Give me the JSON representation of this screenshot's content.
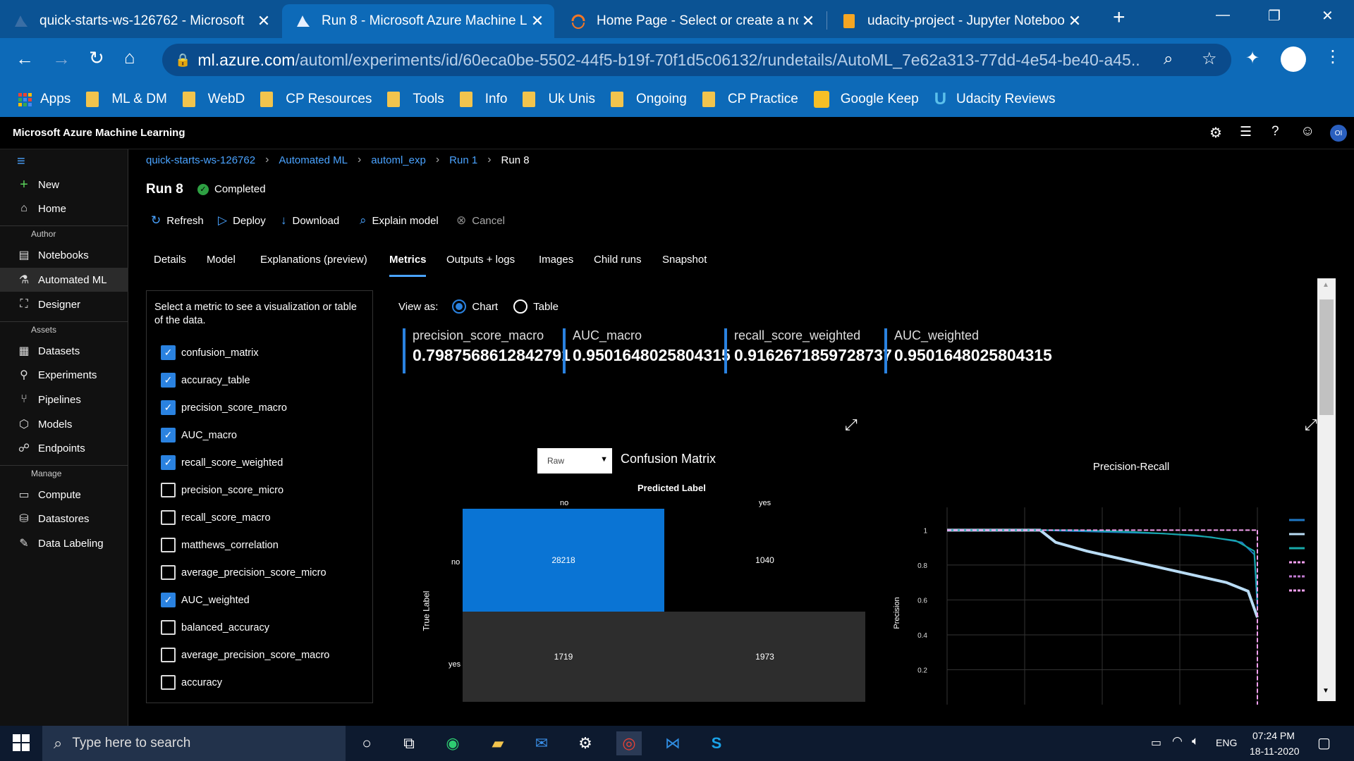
{
  "browser": {
    "tabs": [
      {
        "title": "quick-starts-ws-126762 - Microsoft",
        "icon": "azure-icon"
      },
      {
        "title": "Run 8 - Microsoft Azure Machine Le",
        "icon": "azure-ml-icon"
      },
      {
        "title": "Home Page - Select or create a note",
        "icon": "jupyter-icon"
      },
      {
        "title": "udacity-project - Jupyter Notebook",
        "icon": "notebook-icon"
      }
    ],
    "url_host": "ml.azure.com",
    "url_path": "/automl/experiments/id/60eca0be-5502-44f5-b19f-70f1d5c06132/rundetails/AutoML_7e62a313-77dd-4e54-be40-a45...",
    "bookmarks": [
      "Apps",
      "ML & DM",
      "WebD",
      "CP Resources",
      "Tools",
      "Info",
      "Uk Unis",
      "Ongoing",
      "CP Practice",
      "Google Keep",
      "Udacity Reviews"
    ]
  },
  "app": {
    "title": "Microsoft Azure Machine Learning",
    "avatar": "OI"
  },
  "sidebar": {
    "top": [
      {
        "label": "New",
        "icon": "plus-icon"
      },
      {
        "label": "Home",
        "icon": "home-icon"
      }
    ],
    "author_label": "Author",
    "author": [
      {
        "label": "Notebooks",
        "icon": "notebook-icon"
      },
      {
        "label": "Automated ML",
        "icon": "automl-icon"
      },
      {
        "label": "Designer",
        "icon": "designer-icon"
      }
    ],
    "assets_label": "Assets",
    "assets": [
      {
        "label": "Datasets",
        "icon": "dataset-icon"
      },
      {
        "label": "Experiments",
        "icon": "flask-icon"
      },
      {
        "label": "Pipelines",
        "icon": "pipeline-icon"
      },
      {
        "label": "Models",
        "icon": "cube-icon"
      },
      {
        "label": "Endpoints",
        "icon": "endpoint-icon"
      }
    ],
    "manage_label": "Manage",
    "manage": [
      {
        "label": "Compute",
        "icon": "monitor-icon"
      },
      {
        "label": "Datastores",
        "icon": "database-icon"
      },
      {
        "label": "Data Labeling",
        "icon": "edit-icon"
      }
    ]
  },
  "breadcrumb": [
    "quick-starts-ws-126762",
    "Automated ML",
    "automl_exp",
    "Run 1",
    "Run 8"
  ],
  "run": {
    "title": "Run 8",
    "status": "Completed"
  },
  "toolbar": {
    "refresh": "Refresh",
    "deploy": "Deploy",
    "download": "Download",
    "explain": "Explain model",
    "cancel": "Cancel"
  },
  "tabs": [
    "Details",
    "Model",
    "Explanations (preview)",
    "Metrics",
    "Outputs + logs",
    "Images",
    "Child runs",
    "Snapshot"
  ],
  "active_tab": "Metrics",
  "metrics_panel": {
    "instruction": "Select a metric to see a visualization or table of the data.",
    "items": [
      {
        "label": "confusion_matrix",
        "checked": true
      },
      {
        "label": "accuracy_table",
        "checked": true
      },
      {
        "label": "precision_score_macro",
        "checked": true
      },
      {
        "label": "AUC_macro",
        "checked": true
      },
      {
        "label": "recall_score_weighted",
        "checked": true
      },
      {
        "label": "precision_score_micro",
        "checked": false
      },
      {
        "label": "recall_score_macro",
        "checked": false
      },
      {
        "label": "matthews_correlation",
        "checked": false
      },
      {
        "label": "average_precision_score_micro",
        "checked": false
      },
      {
        "label": "AUC_weighted",
        "checked": true
      },
      {
        "label": "balanced_accuracy",
        "checked": false
      },
      {
        "label": "average_precision_score_macro",
        "checked": false
      },
      {
        "label": "accuracy",
        "checked": false
      }
    ]
  },
  "view_as": {
    "label": "View as:",
    "chart": "Chart",
    "table": "Table",
    "selected": "Chart"
  },
  "kpis": [
    {
      "name": "precision_score_macro",
      "value": "0.7987568612842791"
    },
    {
      "name": "AUC_macro",
      "value": "0.9501648025804315"
    },
    {
      "name": "recall_score_weighted",
      "value": "0.9162671859728737"
    },
    {
      "name": "AUC_weighted",
      "value": "0.9501648025804315"
    }
  ],
  "confusion": {
    "dropdown": "Raw",
    "title": "Confusion Matrix",
    "predicted_label": "Predicted Label",
    "true_label": "True Label",
    "cols": [
      "no",
      "yes"
    ],
    "rows": [
      "no",
      "yes"
    ],
    "values": [
      [
        28218,
        1040
      ],
      [
        1719,
        1973
      ]
    ]
  },
  "chart_data": {
    "type": "line",
    "title": "Precision-Recall",
    "ylabel": "Precision",
    "yticks": [
      "1",
      "0.8",
      "0.6",
      "0.4",
      "0.2"
    ],
    "ylim": [
      0,
      1.05
    ],
    "xlim": [
      0,
      1
    ],
    "series": [
      {
        "color": "#1f77c4",
        "x": [
          0,
          0.3,
          0.5,
          0.7,
          0.85,
          0.95,
          0.99,
          1
        ],
        "y": [
          1,
          1,
          0.99,
          0.98,
          0.96,
          0.93,
          0.86,
          0.56
        ]
      },
      {
        "color": "#b9dcf5",
        "x": [
          0,
          0.3,
          0.35,
          0.45,
          0.6,
          0.75,
          0.9,
          0.97,
          1
        ],
        "y": [
          1,
          1,
          0.93,
          0.88,
          0.82,
          0.76,
          0.7,
          0.65,
          0.5
        ]
      },
      {
        "color": "#17a9a9",
        "x": [
          0,
          0.4,
          0.6,
          0.8,
          0.93,
          0.99,
          1
        ],
        "y": [
          1,
          1,
          0.99,
          0.97,
          0.94,
          0.88,
          0.6
        ]
      }
    ]
  },
  "taskbar": {
    "search_placeholder": "Type here to search",
    "lang": "ENG",
    "time": "07:24 PM",
    "date": "18-11-2020"
  }
}
